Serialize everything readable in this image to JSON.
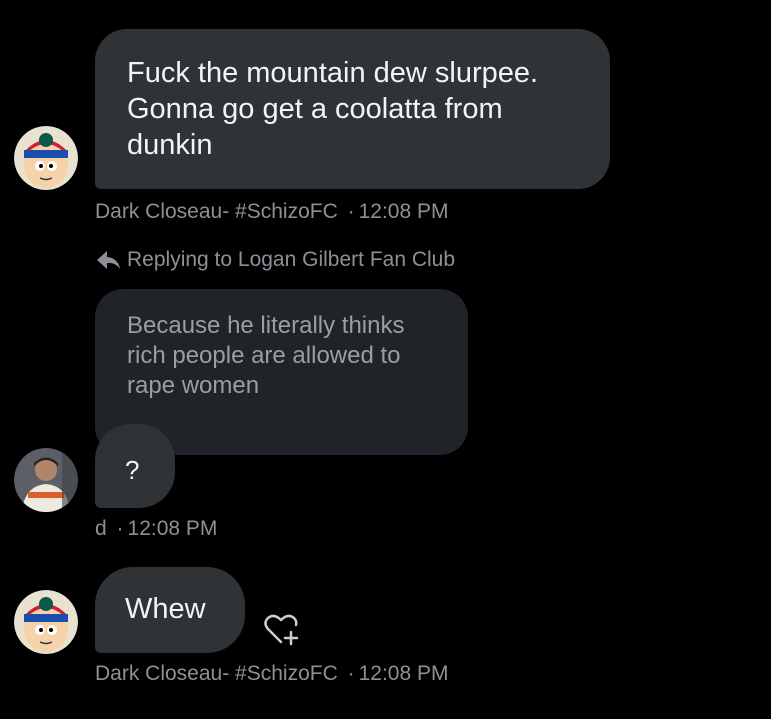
{
  "messages": [
    {
      "text_lines": [
        "Fuck the mountain dew slurpee.",
        "Gonna go get a coolatta from",
        "dunkin"
      ],
      "sender": "Dark Closeau- #SchizoFC",
      "time": "12:08 PM"
    },
    {
      "reply_label": "Replying to Logan Gilbert Fan Club",
      "quoted_lines": [
        "Because he literally thinks",
        "rich people are allowed to",
        "rape women"
      ],
      "text": "?",
      "sender": "d",
      "time": "12:08 PM"
    },
    {
      "text": "Whew",
      "sender": "Dark Closeau- #SchizoFC",
      "time": "12:08 PM"
    }
  ],
  "separator": "·",
  "icons": {
    "reply": "reply-arrow-icon",
    "react": "heart-plus-icon"
  },
  "colors": {
    "background": "#000000",
    "bubble": "#2f3336",
    "quoted_bubble": "#202327",
    "meta_text": "#8b9196"
  }
}
